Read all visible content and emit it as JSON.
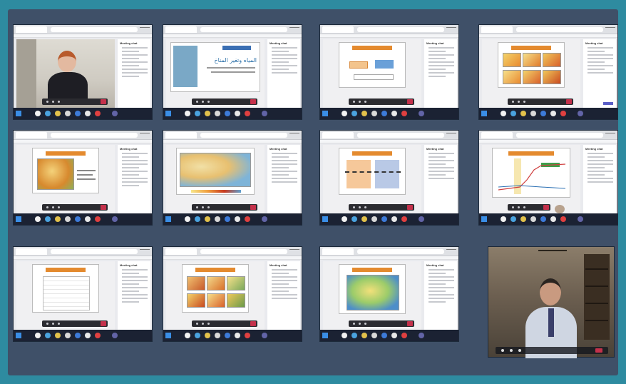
{
  "meeting": {
    "panel_title": "Meeting chat",
    "slide_title_climate": "المياه وتغير المناخ"
  },
  "colors": {
    "outer_frame": "#2e8ba0",
    "board": "#3f5068",
    "slide_header": "#e48a2e",
    "hangup": "#c4314b",
    "chat_button": "#5b5fc7"
  },
  "icons": [
    "camera-icon",
    "mic-icon",
    "share-icon",
    "hangup-icon",
    "chat-icon",
    "participants-icon"
  ]
}
